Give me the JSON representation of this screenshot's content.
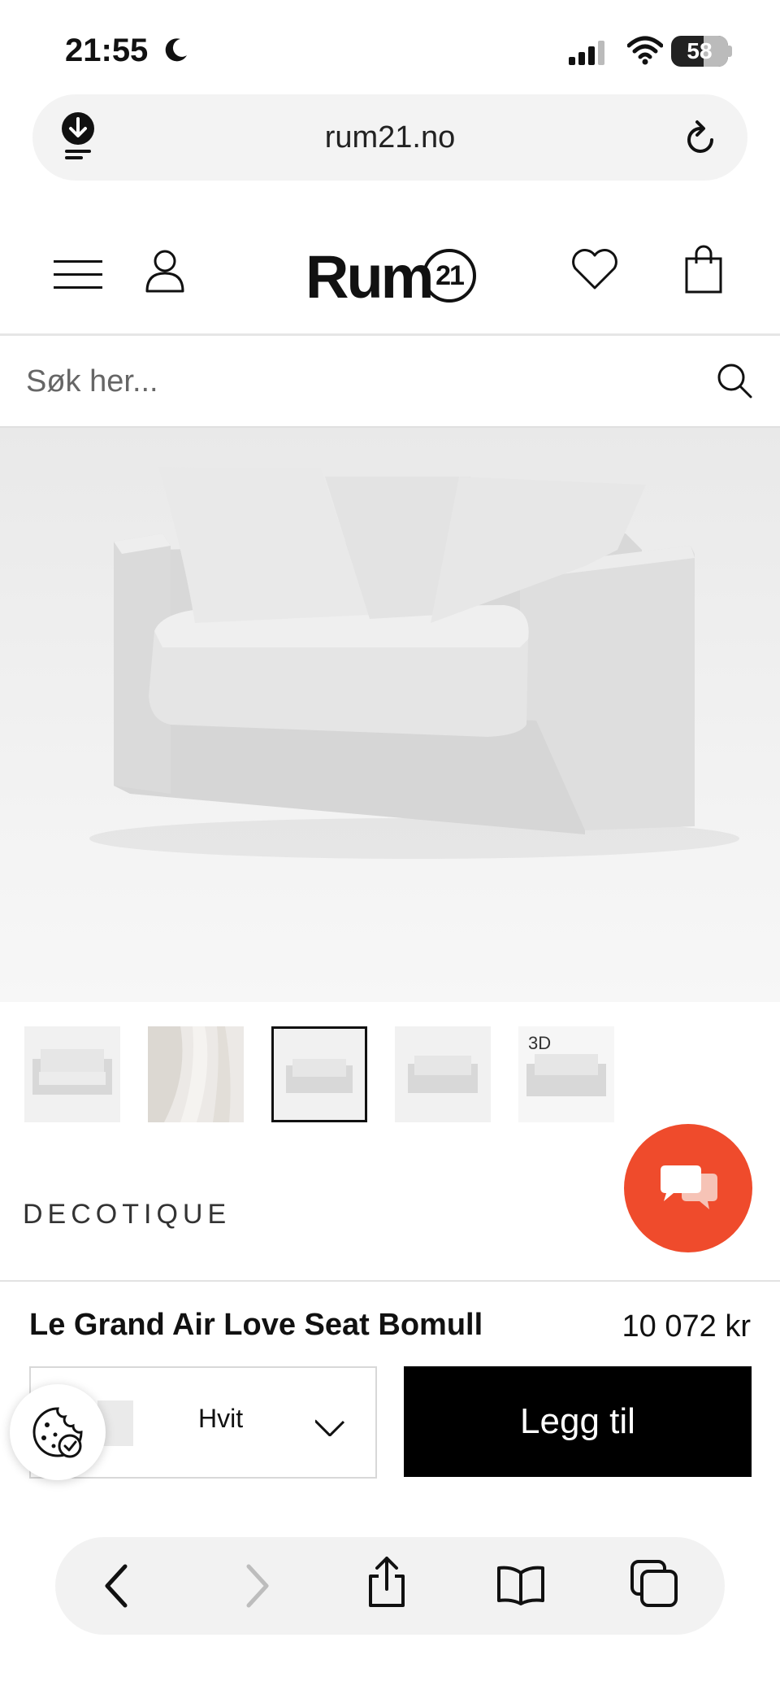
{
  "status_bar": {
    "time": "21:55",
    "battery": "58"
  },
  "browser": {
    "url": "rum21.no"
  },
  "site": {
    "logo_text": "Rum",
    "logo_badge": "21",
    "search_placeholder": "Søk her..."
  },
  "product": {
    "thumb_3d_badge": "3D",
    "brand": "DECOTIQUE",
    "name": "Le Grand Air Love Seat Bomull",
    "price": "10 072 kr",
    "variant_label": "Hvit",
    "add_button": "Legg til"
  },
  "colors": {
    "accent_chat": "#ef4b2c",
    "button_bg": "#000000"
  }
}
